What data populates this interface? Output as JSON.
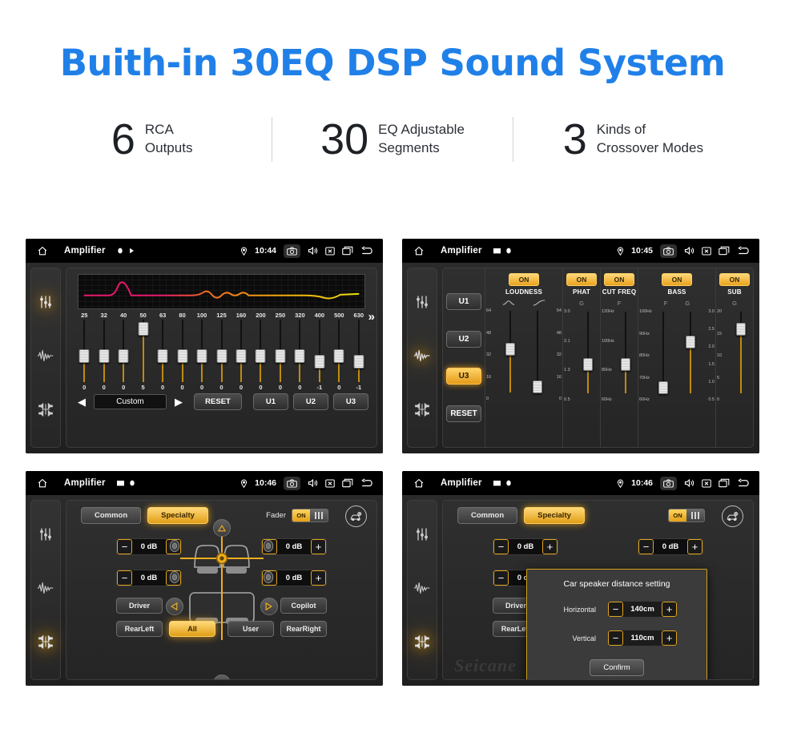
{
  "hero": {
    "title": "Buith-in 30EQ DSP Sound System",
    "stats": [
      {
        "number": "6",
        "line1": "RCA",
        "line2": "Outputs"
      },
      {
        "number": "30",
        "line1": "EQ Adjustable",
        "line2": "Segments"
      },
      {
        "number": "3",
        "line1": "Kinds of",
        "line2": "Crossover Modes"
      }
    ]
  },
  "colors": {
    "title_blue": "#2080e8",
    "accent_amber": "#e5a117",
    "panel_dark": "#252525",
    "statusbar_black": "#000000"
  },
  "statusbar": {
    "app_title": "Amplifier",
    "home_icon": "home-icon",
    "location_icon": "location-pin-icon",
    "camera_icon": "camera-icon",
    "volume_icon": "speaker-icon",
    "close_icon": "x-box-icon",
    "recents_icon": "recent-apps-icon",
    "back_icon": "back-arrow-icon"
  },
  "rail": {
    "items": [
      {
        "icon": "equalizer-sliders-icon",
        "name": "equalizer"
      },
      {
        "icon": "waveform-icon",
        "name": "waveform"
      },
      {
        "icon": "balance-fader-icon",
        "name": "balance"
      }
    ]
  },
  "panel1": {
    "time": "10:44",
    "active_rail": 0,
    "frequencies": [
      "25",
      "32",
      "40",
      "50",
      "63",
      "80",
      "100",
      "125",
      "160",
      "200",
      "250",
      "320",
      "400",
      "500",
      "630"
    ],
    "values": [
      "0",
      "0",
      "0",
      "5",
      "0",
      "0",
      "0",
      "0",
      "0",
      "0",
      "0",
      "0",
      "-1",
      "0",
      "-1"
    ],
    "knob_pcts": [
      58,
      58,
      58,
      14,
      58,
      58,
      58,
      58,
      58,
      58,
      58,
      58,
      66,
      58,
      66
    ],
    "next_icon": "double-chevron-right-icon",
    "prev_arrow": "◀",
    "next_arrow": "▶",
    "preset": "Custom",
    "reset_label": "RESET",
    "user_presets": [
      "U1",
      "U2",
      "U3"
    ],
    "curve_colors": [
      "#e8176b",
      "#ef6b1d",
      "#f0c20e",
      "#ece10c"
    ]
  },
  "panel2": {
    "time": "10:45",
    "active_rail": 1,
    "left_buttons": [
      "U1",
      "U2",
      "U3"
    ],
    "active_left": "U3",
    "reset_label": "RESET",
    "columns": [
      {
        "label": "LOUDNESS",
        "state": "ON",
        "sliders": [
          {
            "axis": "",
            "ticks": [
              "64",
              "48",
              "32",
              "16",
              "0"
            ],
            "knob_pct": 45,
            "side": "left"
          },
          {
            "axis": "",
            "ticks": [
              "64",
              "48",
              "32",
              "16",
              "0"
            ],
            "knob_pct": 88,
            "side": "right"
          }
        ]
      },
      {
        "label": "PHAT",
        "state": "ON",
        "sliders": [
          {
            "axis": "G",
            "ticks": [
              "3.0",
              "2.1",
              "1.3",
              "0.5"
            ],
            "knob_pct": 62,
            "side": "left"
          }
        ]
      },
      {
        "label": "CUT FREQ",
        "state": "ON",
        "sliders": [
          {
            "axis": "F",
            "ticks": [
              "120Hz",
              "100Hz",
              "80Hz",
              "60Hz"
            ],
            "knob_pct": 62,
            "side": "left"
          }
        ]
      },
      {
        "label": "BASS",
        "state": "ON",
        "sliders": [
          {
            "axis": "F",
            "ticks": [
              "100Hz",
              "90Hz",
              "80Hz",
              "70Hz",
              "60Hz"
            ],
            "knob_pct": 88,
            "side": "left"
          },
          {
            "axis": "G",
            "ticks": [
              "3.0",
              "2.5",
              "2.0",
              "1.5",
              "1.0",
              "0.5"
            ],
            "knob_pct": 36,
            "side": "right"
          }
        ]
      },
      {
        "label": "SUB",
        "state": "ON",
        "sliders": [
          {
            "axis": "G",
            "ticks": [
              "20",
              "15",
              "10",
              "5",
              "0"
            ],
            "knob_pct": 22,
            "side": "left"
          }
        ]
      }
    ]
  },
  "panel3": {
    "time": "10:46",
    "active_rail": 2,
    "tabs": [
      {
        "label": "Common",
        "active": false
      },
      {
        "label": "Specialty",
        "active": true
      }
    ],
    "fader_label": "Fader",
    "fader_state": "ON",
    "car_icon": "car-settings-icon",
    "gain_steppers": [
      {
        "name": "front-left-gain",
        "value": "0 dB"
      },
      {
        "name": "rear-left-gain",
        "value": "0 dB"
      },
      {
        "name": "front-right-gain",
        "value": "0 dB"
      },
      {
        "name": "rear-right-gain",
        "value": "0 dB"
      }
    ],
    "minus": "−",
    "plus": "+",
    "seat_buttons": [
      {
        "label": "Driver",
        "active": false
      },
      {
        "label": "RearLeft",
        "active": false
      },
      {
        "label": "All",
        "active": true
      },
      {
        "label": "User",
        "active": false
      },
      {
        "label": "Copilot",
        "active": false
      },
      {
        "label": "RearRight",
        "active": false
      }
    ],
    "pad_icons": [
      "up-triangle-icon",
      "down-triangle-icon",
      "left-triangle-icon",
      "right-triangle-icon"
    ]
  },
  "panel4": {
    "time": "10:46",
    "active_rail": 2,
    "dialog": {
      "title": "Car speaker distance setting",
      "rows": [
        {
          "label": "Horizontal",
          "value": "140cm"
        },
        {
          "label": "Vertical",
          "value": "110cm"
        }
      ],
      "confirm_label": "Confirm"
    },
    "watermark": "Seicane"
  }
}
